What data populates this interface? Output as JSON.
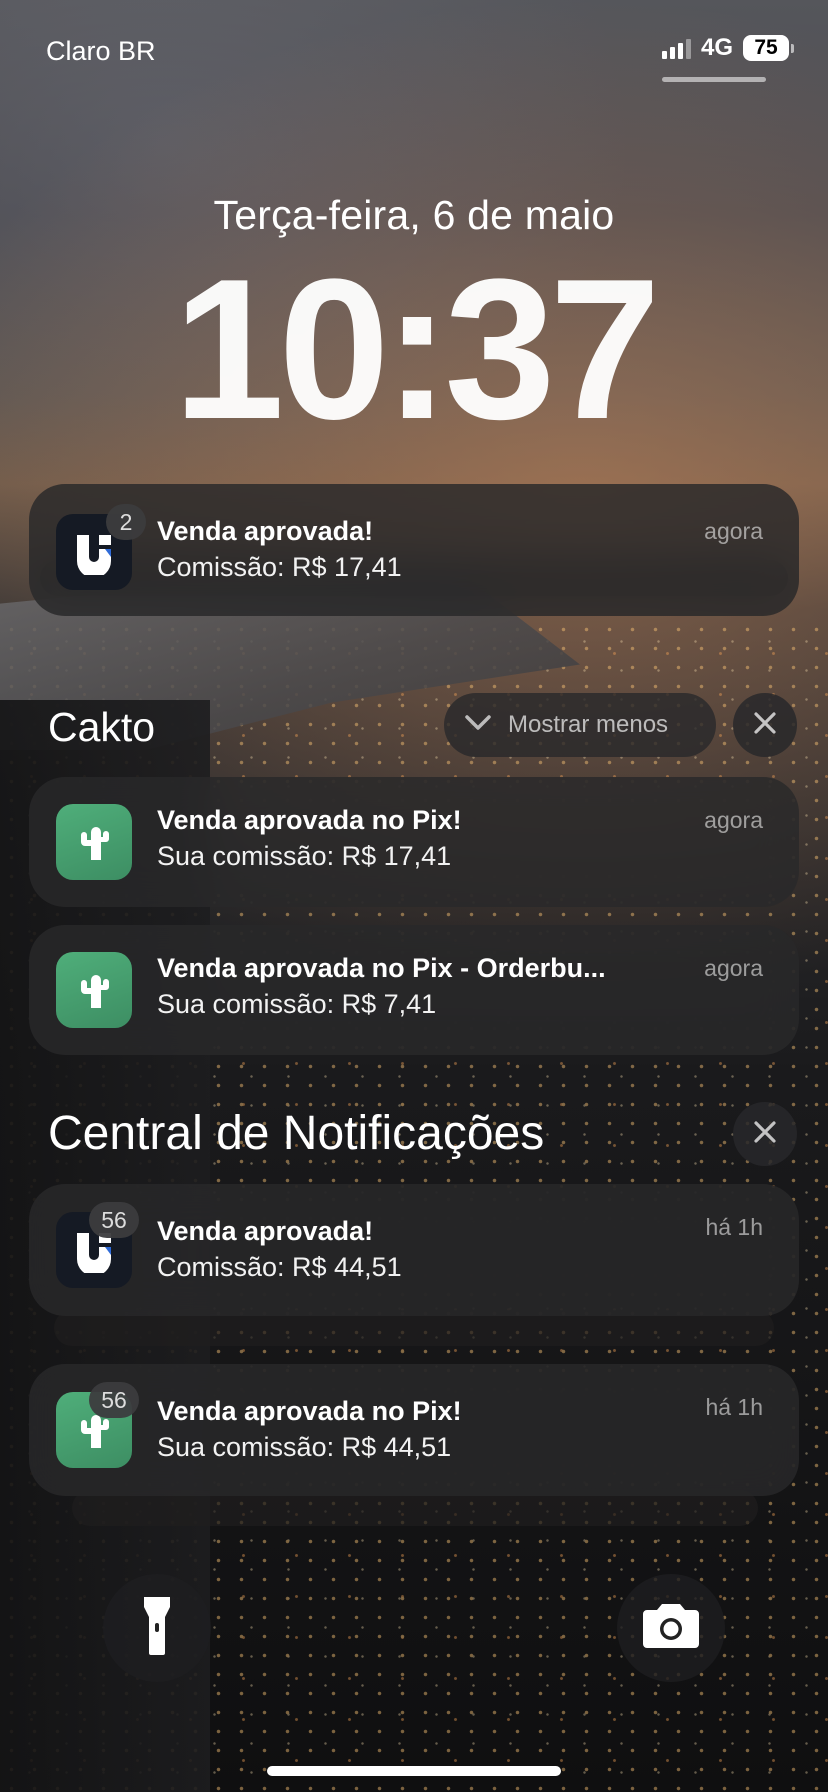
{
  "status_bar": {
    "carrier": "Claro BR",
    "network": "4G",
    "battery_level": "75"
  },
  "lock_screen": {
    "date": "Terça-feira, 6 de maio",
    "time": "10:37"
  },
  "top_notification": {
    "app": "U",
    "badge": "2",
    "title": "Venda aprovada!",
    "body": "Comissão: R$ 17,41",
    "time": "agora"
  },
  "cakto_group": {
    "title": "Cakto",
    "show_less_label": "Mostrar menos",
    "items": [
      {
        "title": "Venda aprovada no Pix!",
        "body": "Sua comissão: R$ 17,41",
        "time": "agora"
      },
      {
        "title": "Venda aprovada no Pix - Orderbu...",
        "body": "Sua comissão: R$ 7,41",
        "time": "agora"
      }
    ]
  },
  "notification_center": {
    "title": "Central de Notificações",
    "items": [
      {
        "badge": "56",
        "title": "Venda aprovada!",
        "body": "Comissão: R$ 44,51",
        "time": "há 1h"
      },
      {
        "badge": "56",
        "title": "Venda aprovada no Pix!",
        "body": "Sua comissão: R$ 44,51",
        "time": "há 1h"
      }
    ]
  },
  "icons": {
    "flashlight": "flashlight-icon",
    "camera": "camera-icon",
    "close": "close-icon",
    "chevron": "chevron-down-icon",
    "cakto_color": "#46a06f",
    "u_app_color": "#151a24"
  }
}
